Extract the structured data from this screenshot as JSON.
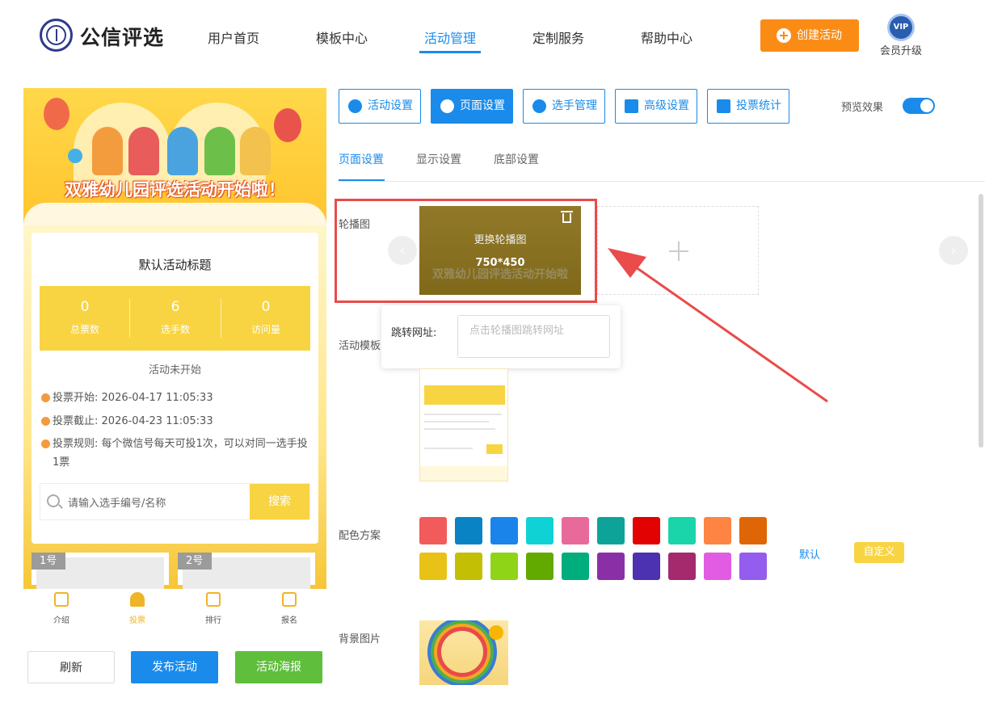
{
  "header": {
    "logo_text": "公信评选",
    "nav": [
      {
        "label": "用户首页",
        "active": false
      },
      {
        "label": "模板中心",
        "active": false
      },
      {
        "label": "活动管理",
        "active": true
      },
      {
        "label": "定制服务",
        "active": false
      },
      {
        "label": "帮助中心",
        "active": false
      }
    ],
    "create_button": "创建活动",
    "vip_badge": "VIP",
    "vip_label": "会员升级"
  },
  "phone": {
    "banner_title": "双雅幼儿园评选活动开始啦！",
    "activity_title": "默认活动标题",
    "stats": [
      {
        "value": "0",
        "label": "总票数"
      },
      {
        "value": "6",
        "label": "选手数"
      },
      {
        "value": "0",
        "label": "访问量"
      }
    ],
    "status": "活动未开始",
    "info": [
      {
        "label": "投票开始:",
        "value": "2026-04-17 11:05:33"
      },
      {
        "label": "投票截止:",
        "value": "2026-04-23 11:05:33"
      },
      {
        "label": "投票规则:",
        "value": "每个微信号每天可投1次，可以对同一选手投1票"
      }
    ],
    "search_placeholder": "请输入选手编号/名称",
    "search_button": "搜索",
    "players": [
      {
        "tag": "1号"
      },
      {
        "tag": "2号"
      }
    ],
    "tabbar": [
      {
        "label": "介绍",
        "icon": "intro-icon",
        "active": false
      },
      {
        "label": "投票",
        "icon": "vote-icon",
        "active": true
      },
      {
        "label": "排行",
        "icon": "ranking-icon",
        "active": false
      },
      {
        "label": "报名",
        "icon": "signup-icon",
        "active": false
      }
    ]
  },
  "bottom_buttons": [
    {
      "label": "刷新",
      "bg": "#ffffff",
      "color": "#333333"
    },
    {
      "label": "发布活动",
      "bg": "#1a8bea",
      "color": "#ffffff"
    },
    {
      "label": "活动海报",
      "bg": "#5fbe3c",
      "color": "#ffffff"
    }
  ],
  "toolbar": {
    "buttons": [
      {
        "label": "活动设置",
        "icon": "star-icon",
        "active": false
      },
      {
        "label": "页面设置",
        "icon": "gear-icon",
        "active": true
      },
      {
        "label": "选手管理",
        "icon": "users-icon",
        "active": false
      },
      {
        "label": "高级设置",
        "icon": "settings-icon",
        "active": false
      },
      {
        "label": "投票统计",
        "icon": "bar-chart-icon",
        "active": false
      }
    ],
    "preview_label": "预览效果",
    "preview_on": true
  },
  "subtabs": [
    {
      "label": "页面设置",
      "active": true
    },
    {
      "label": "显示设置",
      "active": false
    },
    {
      "label": "底部设置",
      "active": false
    }
  ],
  "carousel": {
    "label": "轮播图",
    "replace_text": "更换轮播图",
    "size_text": "750*450",
    "slide_banner_text": "双雅幼儿园评选活动开始啦"
  },
  "popover": {
    "label": "跳转网址:",
    "placeholder": "点击轮播图跳转网址"
  },
  "template_label": "活动模板",
  "color_scheme": {
    "label": "配色方案",
    "colors": [
      "#f25b5b",
      "#0a83c4",
      "#1a84ea",
      "#0fd2d5",
      "#e86a9a",
      "#0ea399",
      "#e20202",
      "#1ad5a9",
      "#fd8443",
      "#df6606",
      "#e8c217",
      "#c3bf04",
      "#8fd417",
      "#63aa00",
      "#00ad7d",
      "#8b2fa6",
      "#4c31b0",
      "#a42a6d",
      "#e15be3",
      "#955ded"
    ],
    "default_link": "默认",
    "custom_button": "自定义"
  },
  "background_label": "背景图片"
}
